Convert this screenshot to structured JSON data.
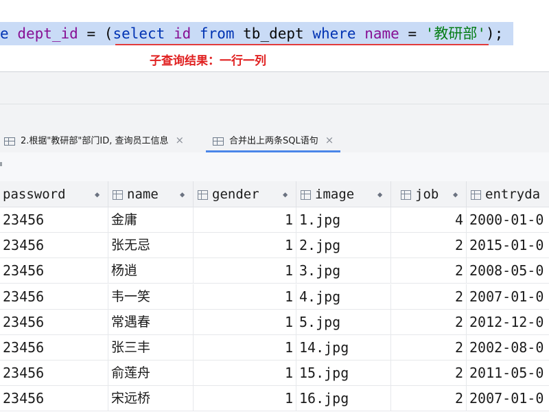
{
  "editor": {
    "code_tokens": {
      "t1": "e",
      "t2": "dept_id",
      "t3": "=",
      "t4": "(",
      "t5": "select",
      "t6": "id",
      "t7": "from",
      "t8": "tb_dept",
      "t9": "where",
      "t10": "name",
      "t11": "=",
      "t12": "'教研部'",
      "t13": ");"
    },
    "annotation": "子查询结果：一行一列"
  },
  "tabs": [
    {
      "label": "2.根据\"教研部\"部门ID, 查询员工信息",
      "close": "×",
      "icon": "table-icon"
    },
    {
      "label": "合并出上两条SQL语句",
      "close": "×",
      "icon": "table-icon"
    }
  ],
  "table": {
    "columns": [
      {
        "label": "password",
        "sort": "◆"
      },
      {
        "label": "name",
        "sort": "◆"
      },
      {
        "label": "gender",
        "sort": "◆"
      },
      {
        "label": "image",
        "sort": "◆"
      },
      {
        "label": "job",
        "sort": "◆"
      },
      {
        "label": "entryda",
        "sort": ""
      }
    ],
    "rows": [
      {
        "password": "23456",
        "name": "金庸",
        "gender": "1",
        "image": "1.jpg",
        "job": "4",
        "entrydate": "2000-01-0"
      },
      {
        "password": "23456",
        "name": "张无忌",
        "gender": "1",
        "image": "2.jpg",
        "job": "2",
        "entrydate": "2015-01-0"
      },
      {
        "password": "23456",
        "name": "杨逍",
        "gender": "1",
        "image": "3.jpg",
        "job": "2",
        "entrydate": "2008-05-0"
      },
      {
        "password": "23456",
        "name": "韦一笑",
        "gender": "1",
        "image": "4.jpg",
        "job": "2",
        "entrydate": "2007-01-0"
      },
      {
        "password": "23456",
        "name": "常遇春",
        "gender": "1",
        "image": "5.jpg",
        "job": "2",
        "entrydate": "2012-12-0"
      },
      {
        "password": "23456",
        "name": "张三丰",
        "gender": "1",
        "image": "14.jpg",
        "job": "2",
        "entrydate": "2002-08-0"
      },
      {
        "password": "23456",
        "name": "俞莲舟",
        "gender": "1",
        "image": "15.jpg",
        "job": "2",
        "entrydate": "2011-05-0"
      },
      {
        "password": "23456",
        "name": "宋远桥",
        "gender": "1",
        "image": "16.jpg",
        "job": "2",
        "entrydate": "2007-01-0"
      }
    ]
  }
}
